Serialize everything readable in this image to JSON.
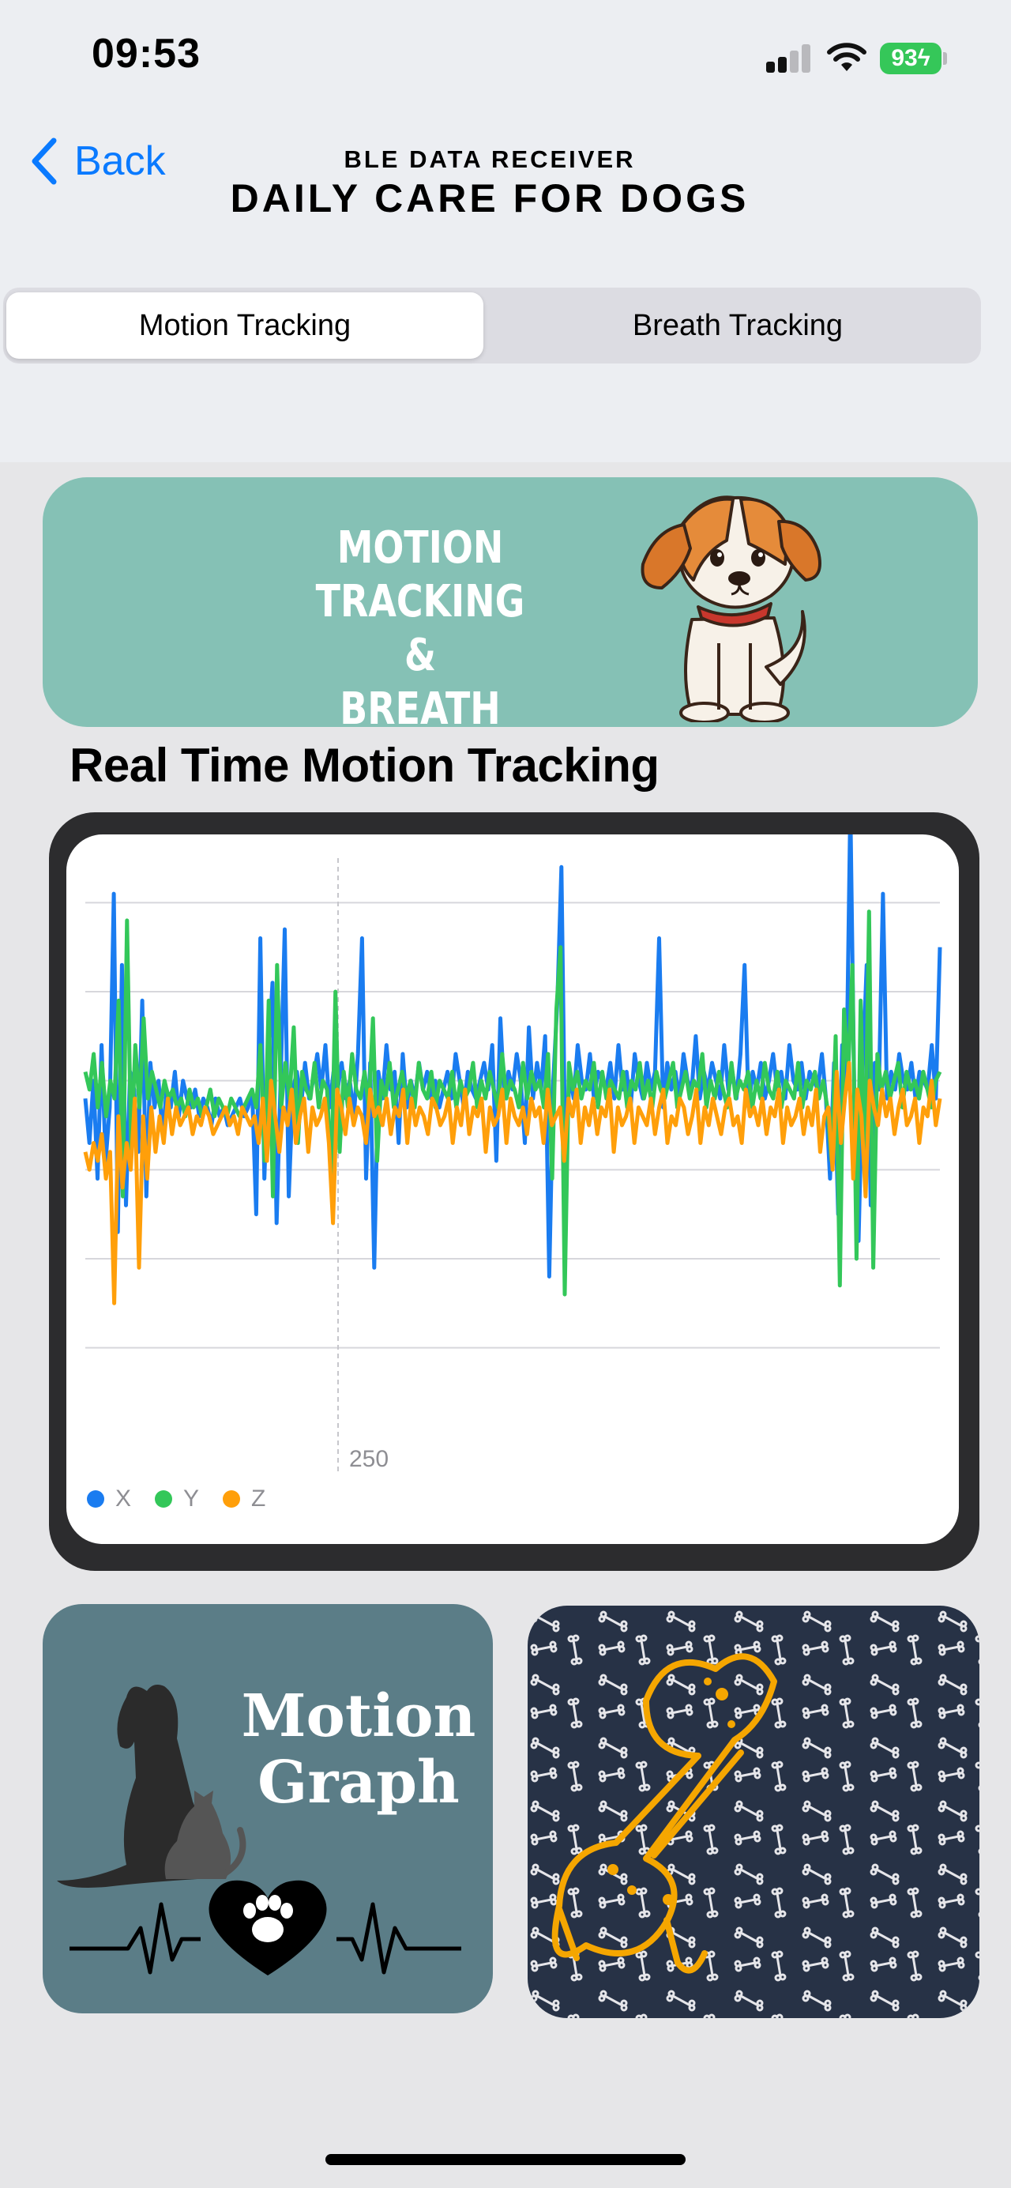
{
  "status_bar": {
    "time": "09:53",
    "battery": "93"
  },
  "nav": {
    "back_label": "Back",
    "subtitle": "BLE DATA RECEIVER",
    "title": "DAILY CARE FOR DOGS"
  },
  "segments": {
    "motion": "Motion Tracking",
    "breath": "Breath Tracking",
    "selected": "Motion Tracking"
  },
  "banner": {
    "line1": "MOTION TRACKING",
    "line2": "&",
    "line3": "BREATH TRACKING"
  },
  "section_title": "Real Time Motion Tracking",
  "motion_graph": {
    "line1": "Motion",
    "line2": "Graph"
  },
  "colors": {
    "accent": "#0a7aff",
    "x": "#1a7cf0",
    "y": "#33c759",
    "z": "#ff9f0a",
    "banner": "#85c1b5"
  },
  "chart_data": {
    "type": "line",
    "x_tick_labels": [
      "250"
    ],
    "grid": true,
    "legend": "bottom-left",
    "ylim": [
      -3,
      3
    ],
    "series": [
      {
        "name": "X",
        "values": [
          0.3,
          -0.2,
          0.5,
          -0.6,
          0.9,
          -0.4,
          0.2,
          2.6,
          -1.2,
          1.8,
          -0.9,
          0.6,
          0.4,
          -0.3,
          1.4,
          -0.8,
          0.7,
          0.2,
          0.5,
          -0.1,
          0.4,
          0.2,
          0.6,
          0.1,
          0.5,
          0.3,
          0.2,
          0.4,
          0.1,
          0.3,
          0.2,
          0.0,
          0.3,
          0.1,
          0.2,
          0.0,
          0.1,
          0.2,
          0.3,
          0.1,
          0.2,
          0.4,
          -1.0,
          2.1,
          -0.6,
          0.8,
          1.6,
          -1.1,
          0.5,
          2.2,
          -0.8,
          0.4,
          0.6,
          0.2,
          0.7,
          0.3,
          0.5,
          0.8,
          0.4,
          0.9,
          0.2,
          0.6,
          0.4,
          0.7,
          0.3,
          0.5,
          0.1,
          0.8,
          2.1,
          -0.6,
          0.7,
          -1.6,
          0.6,
          0.3,
          0.9,
          0.4,
          0.6,
          -0.2,
          0.8,
          0.2,
          0.5,
          0.3,
          0.7,
          0.4,
          0.6,
          0.3,
          0.5,
          0.2,
          0.4,
          0.6,
          0.3,
          0.8,
          0.5,
          0.2,
          0.6,
          0.4,
          0.3,
          0.5,
          0.7,
          0.4,
          0.9,
          -0.4,
          1.2,
          0.3,
          0.6,
          0.4,
          0.8,
          0.5,
          -0.2,
          1.1,
          0.3,
          0.7,
          0.4,
          1.0,
          -1.7,
          0.5,
          1.4,
          2.9,
          -0.6,
          0.6,
          0.3,
          0.9,
          0.5,
          0.4,
          0.8,
          0.3,
          0.6,
          0.5,
          0.4,
          0.7,
          0.3,
          0.9,
          0.4,
          0.6,
          0.2,
          0.8,
          0.5,
          0.3,
          0.7,
          0.4,
          0.6,
          2.1,
          0.2,
          0.7,
          0.4,
          0.6,
          0.3,
          0.8,
          0.5,
          0.4,
          1.0,
          0.3,
          0.6,
          0.4,
          0.7,
          0.5,
          0.3,
          0.9,
          0.4,
          0.6,
          0.3,
          0.8,
          1.8,
          0.2,
          0.6,
          0.4,
          0.7,
          0.3,
          0.5,
          0.8,
          0.4,
          0.6,
          0.3,
          0.9,
          0.5,
          0.4,
          0.7,
          0.3,
          0.6,
          0.5,
          0.4,
          0.8,
          0.3,
          -0.6,
          0.7,
          -1.0,
          0.9,
          0.4,
          3.6,
          0.2,
          -1.3,
          0.6,
          1.8,
          -0.9,
          0.7,
          0.4,
          2.6,
          0.3,
          0.6,
          0.4,
          0.8,
          0.5,
          0.4,
          0.7,
          0.3,
          0.6,
          0.5,
          0.4,
          0.9,
          0.3,
          2.0
        ]
      },
      {
        "name": "Y",
        "values": [
          0.6,
          0.4,
          0.8,
          0.2,
          0.7,
          0.1,
          0.5,
          0.3,
          1.4,
          -0.8,
          2.3,
          -0.3,
          0.9,
          0.2,
          1.2,
          0.3,
          0.6,
          0.4,
          0.2,
          0.5,
          0.3,
          0.4,
          0.2,
          0.3,
          0.1,
          0.4,
          0.2,
          0.3,
          0.1,
          0.2,
          0.4,
          0.1,
          0.3,
          0.2,
          0.1,
          0.3,
          0.2,
          0.1,
          0.2,
          0.3,
          0.4,
          0.2,
          0.9,
          -0.4,
          1.4,
          -0.8,
          1.8,
          0.2,
          0.7,
          0.3,
          1.1,
          -0.2,
          0.6,
          0.4,
          0.3,
          0.7,
          0.2,
          0.5,
          0.4,
          -0.6,
          1.5,
          -0.3,
          0.6,
          0.2,
          0.8,
          0.4,
          0.3,
          0.6,
          0.2,
          1.2,
          -0.4,
          0.5,
          0.3,
          0.7,
          0.2,
          0.4,
          0.6,
          0.3,
          0.5,
          0.2,
          0.7,
          0.4,
          0.3,
          0.6,
          0.2,
          0.5,
          0.4,
          0.3,
          0.6,
          0.2,
          0.5,
          0.3,
          0.4,
          0.7,
          0.2,
          0.5,
          0.3,
          0.6,
          0.4,
          0.2,
          0.8,
          0.3,
          0.5,
          0.4,
          0.2,
          0.7,
          0.3,
          0.6,
          0.4,
          0.5,
          0.2,
          0.8,
          -0.6,
          1.3,
          2.0,
          -1.9,
          0.7,
          0.4,
          0.6,
          0.3,
          0.5,
          0.4,
          0.7,
          0.2,
          0.6,
          0.3,
          0.5,
          0.4,
          0.3,
          0.6,
          0.2,
          0.5,
          0.4,
          0.7,
          0.3,
          0.5,
          0.2,
          0.6,
          0.4,
          0.3,
          0.5,
          0.7,
          0.2,
          0.4,
          0.6,
          0.3,
          0.5,
          0.4,
          0.8,
          0.2,
          0.5,
          0.3,
          0.6,
          0.4,
          0.2,
          0.7,
          0.3,
          0.5,
          0.4,
          0.6,
          0.2,
          0.5,
          0.3,
          0.7,
          0.4,
          0.3,
          0.6,
          0.2,
          0.5,
          0.4,
          0.3,
          0.7,
          0.2,
          0.5,
          0.4,
          0.6,
          0.3,
          0.5,
          0.2,
          -0.4,
          1.0,
          -1.8,
          1.3,
          0.6,
          1.8,
          -1.5,
          1.4,
          -0.6,
          2.4,
          -1.6,
          0.8,
          0.4,
          0.6,
          0.3,
          0.5,
          0.7,
          0.2,
          0.6,
          0.4,
          0.5,
          0.3,
          0.6,
          0.4,
          0.2,
          0.5,
          0.6
        ]
      },
      {
        "name": "Z",
        "values": [
          -0.3,
          -0.5,
          -0.2,
          -0.4,
          -0.1,
          -0.6,
          -0.3,
          -2.0,
          0.1,
          -0.7,
          -0.2,
          -0.5,
          0.3,
          -1.6,
          0.1,
          -0.6,
          0.2,
          -0.3,
          0.1,
          -0.2,
          0.3,
          -0.1,
          0.2,
          0.0,
          0.1,
          0.2,
          -0.1,
          0.1,
          0.0,
          0.2,
          0.1,
          -0.1,
          0.0,
          0.1,
          0.2,
          0.0,
          0.1,
          -0.1,
          0.2,
          0.1,
          0.0,
          0.1,
          -0.2,
          0.3,
          -0.4,
          0.5,
          0.1,
          -0.3,
          0.2,
          0.0,
          0.4,
          -0.2,
          0.1,
          0.3,
          -0.3,
          0.2,
          0.0,
          0.1,
          0.3,
          -0.2,
          -1.1,
          0.4,
          0.2,
          -0.1,
          0.3,
          0.0,
          0.2,
          0.1,
          -0.2,
          0.4,
          0.1,
          0.2,
          0.0,
          0.3,
          -0.1,
          0.2,
          0.1,
          0.4,
          -0.2,
          0.3,
          0.0,
          0.2,
          0.1,
          -0.1,
          0.3,
          0.2,
          0.0,
          0.1,
          0.3,
          -0.2,
          0.2,
          0.0,
          0.4,
          -0.1,
          0.2,
          0.1,
          0.3,
          -0.3,
          0.2,
          0.0,
          0.1,
          0.4,
          -0.2,
          0.3,
          0.1,
          0.0,
          0.2,
          -0.1,
          0.3,
          0.1,
          0.2,
          -0.2,
          0.4,
          0.0,
          0.1,
          0.2,
          -0.4,
          0.3,
          0.1,
          0.4,
          -0.2,
          0.2,
          0.0,
          0.3,
          -0.1,
          0.2,
          0.1,
          0.4,
          -0.3,
          0.2,
          0.0,
          0.1,
          0.3,
          -0.2,
          0.2,
          0.1,
          0.0,
          0.3,
          -0.1,
          0.2,
          0.4,
          -0.2,
          0.1,
          0.0,
          0.3,
          0.2,
          -0.1,
          0.1,
          0.4,
          -0.2,
          0.2,
          0.0,
          0.3,
          0.1,
          -0.1,
          0.2,
          0.3,
          0.0,
          0.1,
          -0.2,
          0.4,
          0.1,
          0.2,
          0.0,
          0.3,
          -0.1,
          0.2,
          0.1,
          0.4,
          -0.2,
          0.2,
          0.0,
          0.1,
          0.3,
          -0.1,
          0.2,
          0.0,
          0.4,
          -0.3,
          0.1,
          0.2,
          -0.5,
          0.6,
          -0.2,
          0.3,
          0.7,
          -0.6,
          0.4,
          0.1,
          -0.8,
          0.5,
          0.2,
          0.0,
          0.4,
          0.1,
          0.3,
          -0.1,
          0.2,
          0.4,
          0.0,
          0.1,
          0.3,
          -0.2,
          0.2,
          0.1,
          0.5,
          0.0,
          0.3
        ]
      }
    ]
  }
}
